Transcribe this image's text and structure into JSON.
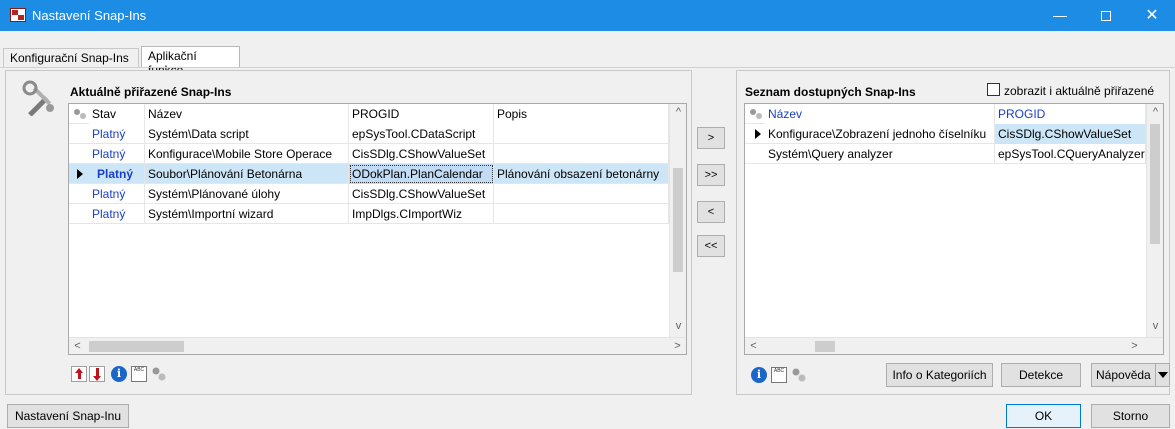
{
  "window": {
    "title": "Nastavení Snap-Ins",
    "controls": {
      "minimize": "—",
      "maximize": "",
      "close": "✕"
    }
  },
  "tabs": [
    {
      "label": "Konfigurační Snap-Ins",
      "active": false
    },
    {
      "label": "Aplikační funkce",
      "active": true
    }
  ],
  "left_panel": {
    "title": "Aktuálně přiřazené Snap-Ins",
    "columns": [
      "Stav",
      "Název",
      "PROGID",
      "Popis"
    ],
    "rows": [
      {
        "stav": "Platný",
        "nazev": "Systém\\Data script",
        "progid": "epSysTool.CDataScript",
        "popis": "",
        "selected": false
      },
      {
        "stav": "Platný",
        "nazev": "Konfigurace\\Mobile Store Operace",
        "progid": "CisSDlg.CShowValueSet",
        "popis": "",
        "selected": false
      },
      {
        "stav": "Platný",
        "nazev": "Soubor\\Plánování Betonárna",
        "progid": "ODokPlan.PlanCalendar",
        "popis": "Plánování obsazení betonárny",
        "selected": true
      },
      {
        "stav": "Platný",
        "nazev": "Systém\\Plánované úlohy",
        "progid": "CisSDlg.CShowValueSet",
        "popis": "",
        "selected": false
      },
      {
        "stav": "Platný",
        "nazev": "Systém\\Importní wizard",
        "progid": "ImpDlgs.CImportWiz",
        "popis": "",
        "selected": false
      }
    ]
  },
  "transfer_buttons": {
    "add": ">",
    "add_all": ">>",
    "remove": "<",
    "remove_all": "<<"
  },
  "right_panel": {
    "title": "Seznam dostupných Snap-Ins",
    "checkbox_label": "zobrazit i aktuálně přiřazené",
    "columns": [
      "Název",
      "PROGID"
    ],
    "rows": [
      {
        "nazev": "Konfigurace\\Zobrazení jednoho číselníku",
        "progid": "CisSDlg.CShowValueSet",
        "current": true
      },
      {
        "nazev": "Systém\\Query analyzer",
        "progid": "epSysTool.CQueryAnalyzer",
        "current": false
      }
    ],
    "buttons": {
      "info": "Info o Kategoriích",
      "detect": "Detekce",
      "help": "Nápověda"
    }
  },
  "footer": {
    "settings": "Nastavení Snap-Inu",
    "ok": "OK",
    "cancel": "Storno"
  },
  "icons": {
    "info": "i",
    "abc": "ABC",
    "scroll_up": "^",
    "scroll_down": "v",
    "scroll_left": "<",
    "scroll_right": ">"
  },
  "colors": {
    "titlebar": "#1d8ce5",
    "selection": "#cde6f7",
    "status_text": "#1a3fc7",
    "arrow_red": "#c0141d"
  }
}
